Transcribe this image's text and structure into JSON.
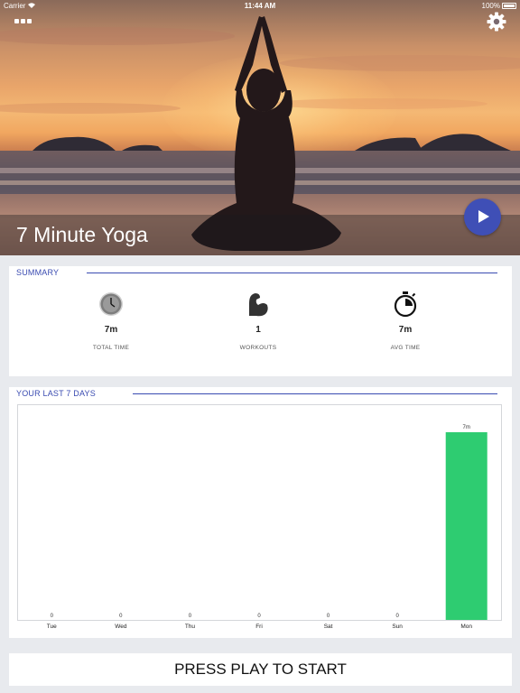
{
  "status_bar": {
    "carrier": "Carrier",
    "wifi_icon": "wifi-icon",
    "time": "11:44 AM",
    "battery_percent": "100%",
    "battery_icon": "battery-icon"
  },
  "header": {
    "menu_icon": "grid-dots-icon",
    "settings_icon": "gear-icon",
    "title": "7 Minute Yoga",
    "play_icon": "play-icon"
  },
  "summary": {
    "heading": "SUMMARY",
    "stats": [
      {
        "icon": "clock-icon",
        "value": "7m",
        "label": "TOTAL TIME"
      },
      {
        "icon": "flexed-arm-icon",
        "value": "1",
        "label": "WORKOUTS"
      },
      {
        "icon": "stopwatch-icon",
        "value": "7m",
        "label": "AVG TIME"
      }
    ]
  },
  "last_days": {
    "heading": "YOUR LAST 7 DAYS"
  },
  "chart_data": {
    "type": "bar",
    "categories": [
      "Tue",
      "Wed",
      "Thu",
      "Fri",
      "Sat",
      "Sun",
      "Mon"
    ],
    "values": [
      0,
      0,
      0,
      0,
      0,
      0,
      7
    ],
    "value_labels": [
      "0",
      "0",
      "0",
      "0",
      "0",
      "0",
      "7m"
    ],
    "bar_color": "#2ecc71",
    "ylim": [
      0,
      7
    ],
    "grid": false
  },
  "footer": {
    "start_label": "PRESS PLAY TO START"
  },
  "colors": {
    "accent": "#3a4bb1",
    "play_button": "#3f4fb6",
    "bar": "#2ecc71",
    "background": "#e8eaee"
  }
}
